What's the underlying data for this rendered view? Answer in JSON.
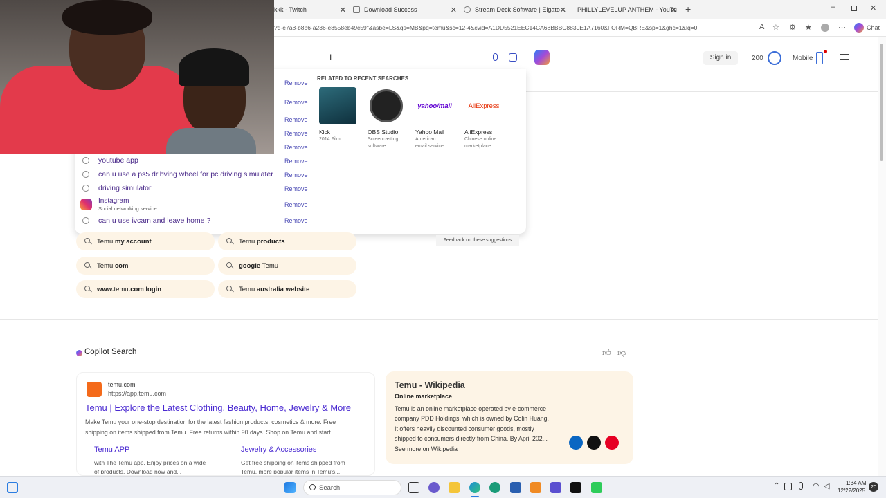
{
  "tabs": [
    {
      "label": "kkk - Twitch"
    },
    {
      "label": "Download Success"
    },
    {
      "label": "Stream Deck Software | Elgato"
    },
    {
      "label": "PHILLYLEVELUP ANTHEM - YouTube"
    }
  ],
  "address": {
    "url": "?d-e7a8-b8b6-a236-e8558eb49c59\"&asbe=LS&qs=MB&pq=temu&sc=12-4&cvid=A1DD5521EEC14CA68BBBC8830E1A7160&FORM=QBRE&sp=1&ghc=1&lq=0"
  },
  "header": {
    "sign_in": "Sign in",
    "points": "200",
    "mobile": "Mobile",
    "chat": "Chat"
  },
  "dropdown": {
    "remove_label": "Remove",
    "related_heading": "RELATED TO RECENT SEARCHES",
    "history": [
      {
        "text": "youtube app"
      },
      {
        "text": "can u use a ps5 dribving wheel for pc driving simulater"
      },
      {
        "text": "driving simulator"
      },
      {
        "text": "can u use ivcam and leave home ?"
      }
    ],
    "instagram": {
      "title": "Instagram",
      "subtitle": "Social networking service"
    },
    "related": [
      {
        "title": "Kick",
        "sub1": "2014 Film",
        "sub2": ""
      },
      {
        "title": "OBS Studio",
        "sub1": "Screencasting",
        "sub2": "software"
      },
      {
        "title": "Yahoo Mail",
        "sub1": "American",
        "sub2": "email service",
        "logo": "yahoo/mail"
      },
      {
        "title": "AliExpress",
        "sub1": "Chinese online",
        "sub2": "marketplace",
        "logo": "AliExpress"
      }
    ],
    "feedback": "Feedback on these suggestions"
  },
  "suggestions": [
    {
      "pre": "Temu ",
      "bold": "my account",
      "post": ""
    },
    {
      "pre": "Temu ",
      "bold": "products",
      "post": ""
    },
    {
      "pre": "Temu ",
      "bold": "com",
      "post": ""
    },
    {
      "pre": "",
      "bold": "google",
      "post": " Temu"
    },
    {
      "pre": "",
      "bold": "www.",
      "post": "temu",
      "post2": ".com login"
    },
    {
      "pre": "Temu ",
      "bold": "australia website",
      "post": ""
    }
  ],
  "copilot": {
    "label": "Copilot Search"
  },
  "result": {
    "site_name": "temu.com",
    "site_url": "https://app.temu.com",
    "title": "Temu | Explore the Latest Clothing, Beauty, Home, Jewelry & More",
    "snippet_line1": "Make Temu your one-stop destination for the latest fashion products, cosmetics & more. Free",
    "snippet_line2": "shipping on items shipped from Temu. Free returns within 90 days. Shop on Temu and start ...",
    "sublinks": [
      {
        "title": "Temu APP",
        "line1": "with The Temu app. Enjoy prices on a wide",
        "line2": "of products. Download now and..."
      },
      {
        "title": "Jewelry & Accessories",
        "line1": "Get free shipping on items shipped from",
        "line2": "Temu, more popular items in Temu's..."
      }
    ]
  },
  "wiki": {
    "title": "Temu - Wikipedia",
    "subtitle": "Online marketplace",
    "line1": "Temu is an online marketplace operated by e-commerce",
    "line2": "company PDD Holdings, which is owned by Colin Huang.",
    "line3": "It offers heavily discounted consumer goods, mostly",
    "line4": "shipped to consumers directly from China. By April 202...",
    "more": "See more on Wikipedia"
  },
  "taskbar": {
    "search": "Search",
    "time": "1:34 AM",
    "date": "12/22/2025",
    "badge": "20"
  },
  "colors": {
    "accent": "#4a2ad1",
    "pill_bg": "#fdf4e6",
    "wiki_bg": "#fdf4e6"
  }
}
